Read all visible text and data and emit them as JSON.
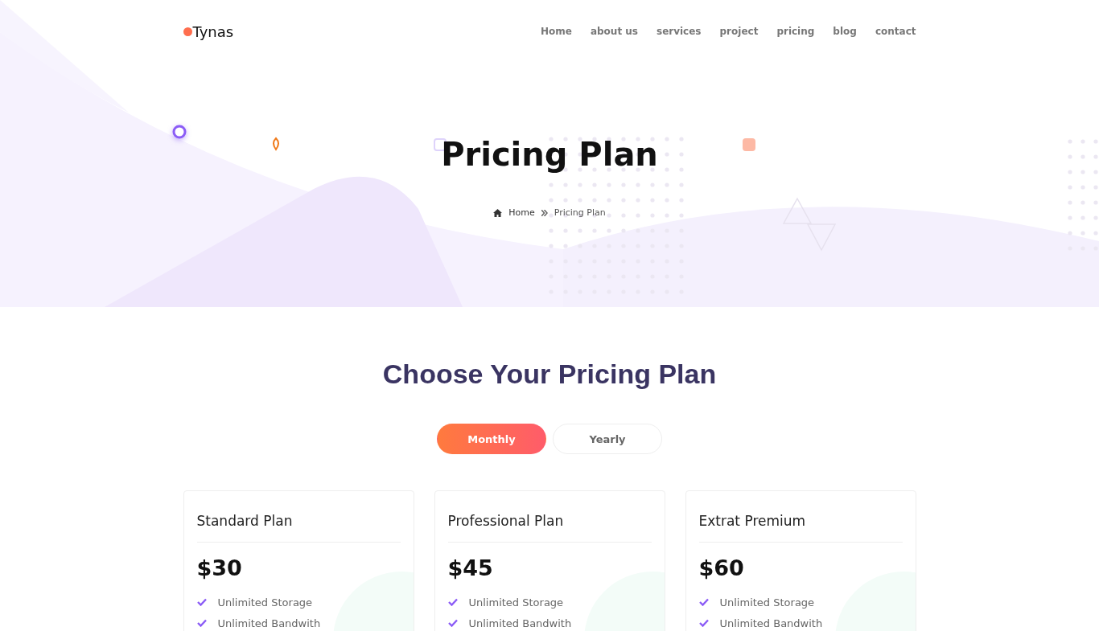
{
  "logo": "Tynas",
  "nav": [
    {
      "label": "Home"
    },
    {
      "label": "about us"
    },
    {
      "label": "services"
    },
    {
      "label": "project"
    },
    {
      "label": "pricing"
    },
    {
      "label": "blog"
    },
    {
      "label": "contact"
    }
  ],
  "hero": {
    "title": "Pricing Plan",
    "breadcrumb": [
      "Home",
      "Pricing Plan"
    ]
  },
  "section_title": "Choose Your Pricing Plan",
  "billing_toggle": [
    {
      "label": "Monthly",
      "selected": true
    },
    {
      "label": "Yearly",
      "selected": false
    }
  ],
  "plans": [
    {
      "name": "Standard Plan",
      "price": "$30",
      "features": [
        "Unlimited Storage",
        "Unlimited Bandwith"
      ]
    },
    {
      "name": "Professional Plan",
      "price": "$45",
      "features": [
        "Unlimited Storage",
        "Unlimited Bandwith"
      ]
    },
    {
      "name": "Extrat Premium",
      "price": "$60",
      "features": [
        "Unlimited Storage",
        "Unlimited Bandwith"
      ]
    }
  ]
}
